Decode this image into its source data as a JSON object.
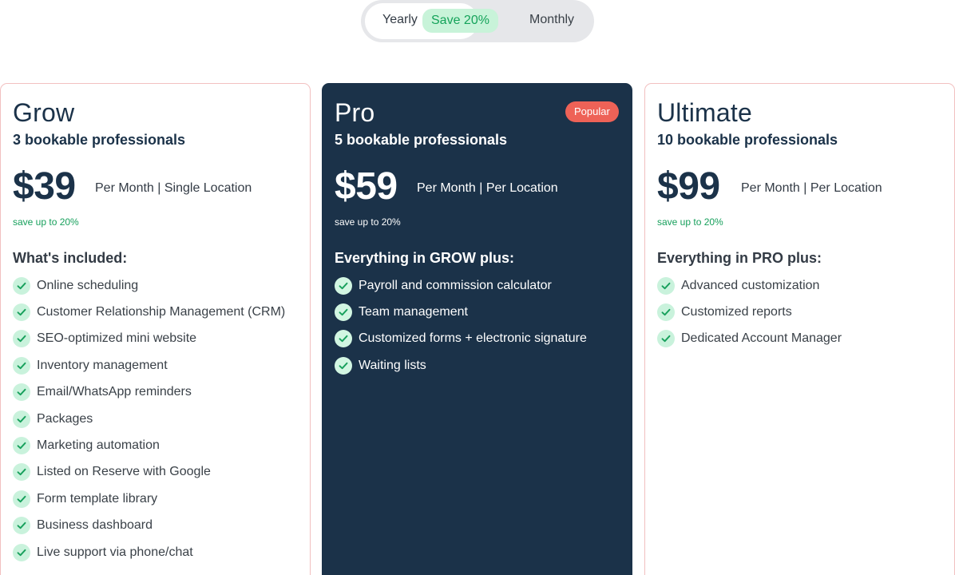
{
  "billing_toggle": {
    "yearly_label": "Yearly",
    "save_label": "Save 20%",
    "monthly_label": "Monthly",
    "selected": "Yearly"
  },
  "plans": [
    {
      "name": "Grow",
      "subtitle": "3 bookable professionals",
      "price": "$39",
      "price_note": "Per Month | Single Location",
      "save_note": "save up to 20%",
      "included_heading": "What's included:",
      "features": [
        "Online scheduling",
        "Customer Relationship Management (CRM)",
        "SEO-optimized mini website",
        "Inventory management",
        "Email/WhatsApp reminders",
        "Packages",
        "Marketing automation",
        "Listed on Reserve with Google",
        "Form template library",
        "Business dashboard",
        "Live support via phone/chat"
      ]
    },
    {
      "name": "Pro",
      "badge": "Popular",
      "subtitle": "5 bookable professionals",
      "price": "$59",
      "price_note": "Per Month | Per Location",
      "save_note": "save up to 20%",
      "included_heading": "Everything in GROW plus:",
      "features": [
        "Payroll and commission calculator",
        "Team management",
        "Customized forms + electronic signature",
        "Waiting lists"
      ]
    },
    {
      "name": "Ultimate",
      "subtitle": "10 bookable professionals",
      "price": "$99",
      "price_note": "Per Month | Per Location",
      "save_note": "save up to 20%",
      "included_heading": "Everything in PRO plus:",
      "features": [
        "Advanced customization",
        "Customized reports",
        "Dedicated Account Manager"
      ]
    }
  ],
  "icons": {
    "feature_check": "check-icon"
  },
  "colors": {
    "navy": "#1b3249",
    "green": "#17a05c",
    "check_bg": "#c9f2dc",
    "badge": "#ee6257",
    "card_border": "#f2c0c0"
  }
}
